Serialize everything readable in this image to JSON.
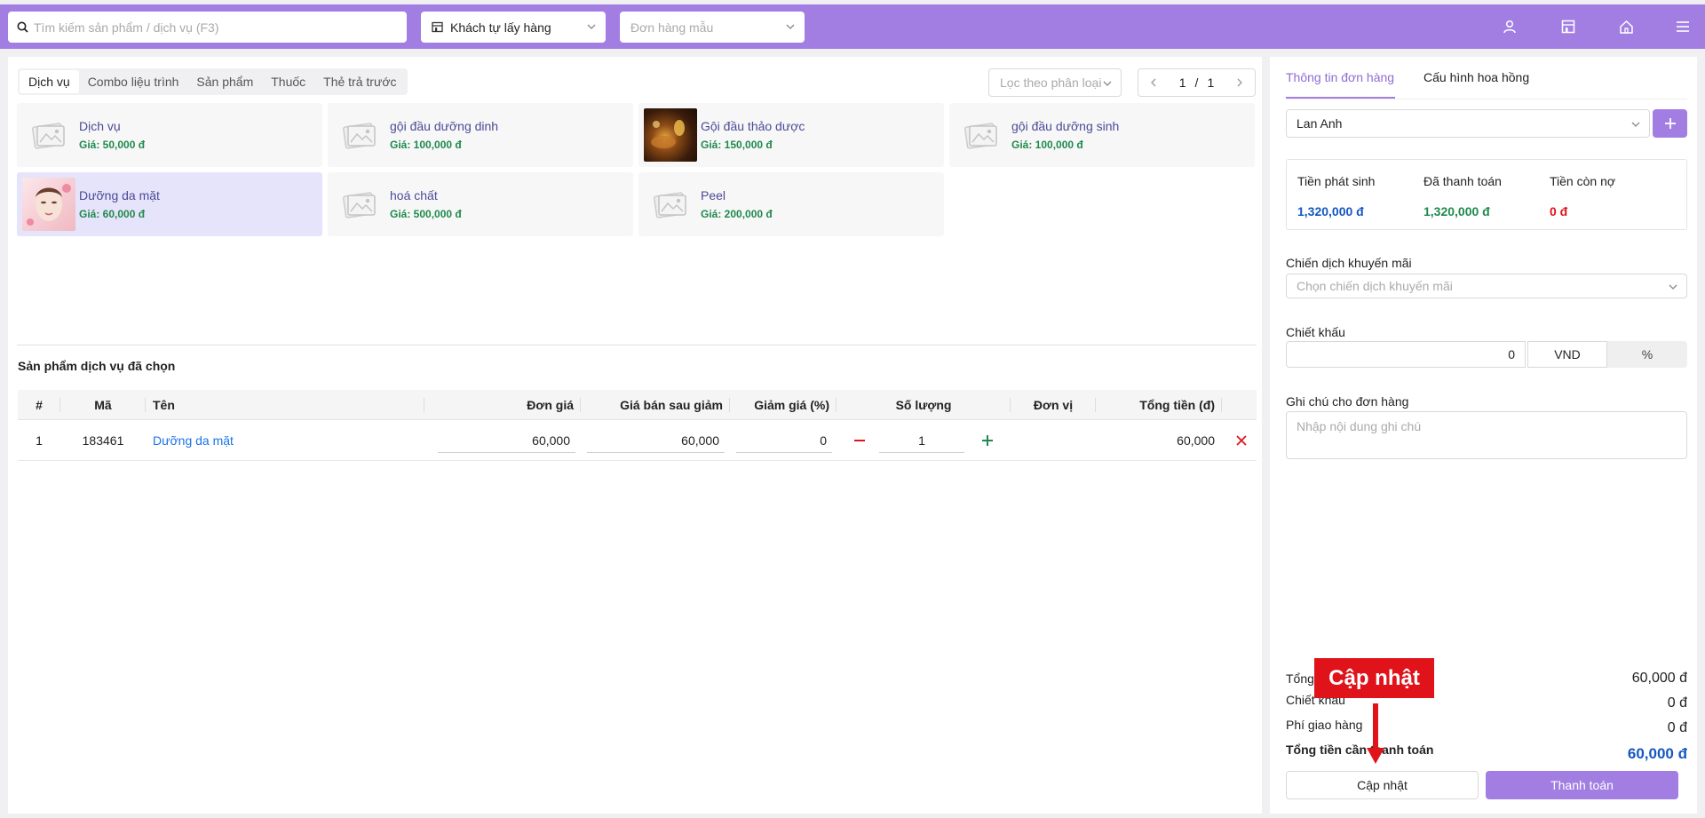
{
  "topbar": {
    "search_placeholder": "Tìm kiếm sản phẩm / dịch vụ (F3)",
    "shipping_select": "Khách tự lấy hàng",
    "template_placeholder": "Đơn hàng mẫu",
    "icons": [
      "user-icon",
      "store-icon",
      "home-icon",
      "menu-icon"
    ]
  },
  "catalog": {
    "tabs": [
      "Dịch vụ",
      "Combo liệu trình",
      "Sản phẩm",
      "Thuốc",
      "Thẻ trả trước"
    ],
    "active_tab": "Dịch vụ",
    "filter_placeholder": "Lọc theo phân loại",
    "pager": {
      "current": "1",
      "sep": "/",
      "total": "1"
    },
    "items": [
      {
        "name": "Dịch vụ",
        "price": "Giá: 50,000 đ"
      },
      {
        "name": "gội đầu dưỡng dinh",
        "price": "Giá: 100,000 đ"
      },
      {
        "name": "Gội đầu thảo dược",
        "price": "Giá: 150,000 đ"
      },
      {
        "name": "gội đầu dưỡng sinh",
        "price": "Giá: 100,000 đ"
      },
      {
        "name": "Dưỡng da mặt",
        "price": "Giá: 60,000 đ"
      },
      {
        "name": "hoá chất",
        "price": "Giá: 500,000 đ"
      },
      {
        "name": "Peel",
        "price": "Giá: 200,000 đ"
      }
    ]
  },
  "selected": {
    "title": "Sản phẩm dịch vụ đã chọn",
    "columns": {
      "idx": "#",
      "code": "Mã",
      "name": "Tên",
      "unit_price": "Đơn giá",
      "sale_price": "Giá bán sau giảm",
      "discount": "Giảm giá (%)",
      "qty": "Số lượng",
      "unit": "Đơn vị",
      "total": "Tổng tiền (đ)"
    },
    "rows": [
      {
        "idx": "1",
        "code": "183461",
        "name": "Dưỡng da mặt",
        "unit_price": "60,000",
        "sale_price": "60,000",
        "discount": "0",
        "qty": "1",
        "unit": "",
        "total": "60,000"
      }
    ]
  },
  "order": {
    "tabs": [
      "Thông tin đơn hàng",
      "Cấu hình hoa hồng"
    ],
    "customer": "Lan Anh",
    "summary": {
      "incurred_label": "Tiền phát sinh",
      "incurred_value": "1,320,000 đ",
      "paid_label": "Đã thanh toán",
      "paid_value": "1,320,000 đ",
      "debt_label": "Tiền còn nợ",
      "debt_value": "0 đ"
    },
    "promo_label": "Chiến dịch khuyến mãi",
    "promo_placeholder": "Chọn chiến dịch khuyến mãi",
    "discount_label": "Chiết khấu",
    "discount_value": "0",
    "discount_unit_vnd": "VND",
    "discount_unit_pct": "%",
    "note_label": "Ghi chú cho đơn hàng",
    "note_placeholder": "Nhập nội dung ghi chú",
    "totals": {
      "subtotal_label": "Tổng",
      "subtotal_value": "60,000 đ",
      "discount_label": "Chiết khấu",
      "discount_value": "0 đ",
      "shipping_label": "Phí giao hàng",
      "shipping_value": "0 đ",
      "grand_label": "Tổng tiền cần thanh toán",
      "grand_value": "60,000 đ"
    },
    "update_button": "Cập nhật",
    "pay_button": "Thanh toán"
  },
  "annotation": {
    "callout": "Cập nhật"
  },
  "colors": {
    "brand": "#a27ee3",
    "price_green": "#1f8a4c",
    "link_blue": "#1a73e8",
    "debt_red": "#e0131b",
    "callout_red": "#e0131b"
  }
}
